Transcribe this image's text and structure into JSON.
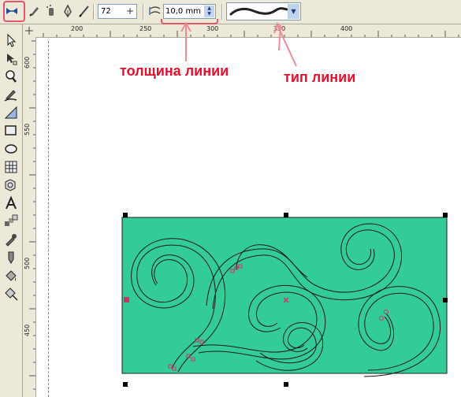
{
  "propertybar": {
    "smoothing_value": "72",
    "smoothing_plus": "+",
    "width_value": "10,0 mm",
    "spin_up": "▲",
    "spin_down": "▼",
    "dropdown_arrow": "▼"
  },
  "rulers": {
    "top_ticks": [
      "200",
      "250",
      "300",
      "350",
      "400"
    ],
    "left_ticks": [
      "600",
      "550",
      "500",
      "450"
    ]
  },
  "annotations": {
    "line_width": "толщина линии",
    "line_type": "тип линии"
  },
  "colors": {
    "accent_highlight": "#e8556a",
    "annotation_red": "#e8102c",
    "fill_green": "#33cc99",
    "toolbar_bg": "#ece9d8"
  },
  "icons": {
    "toolbar": [
      "artistic-media-preset-icon",
      "brush-icon",
      "sprayer-icon",
      "calligraphic-icon",
      "pressure-icon"
    ],
    "toolbox": [
      "pick-tool-icon",
      "shape-tool-icon",
      "zoom-tool-icon",
      "artistic-media-tool-icon",
      "dimension-tool-icon",
      "rectangle-tool-icon",
      "ellipse-tool-icon",
      "graph-paper-tool-icon",
      "basic-shapes-tool-icon",
      "text-tool-icon",
      "interactive-blend-tool-icon",
      "eyedropper-tool-icon",
      "outline-tool-icon",
      "fill-tool-icon",
      "interactive-fill-tool-icon"
    ]
  }
}
